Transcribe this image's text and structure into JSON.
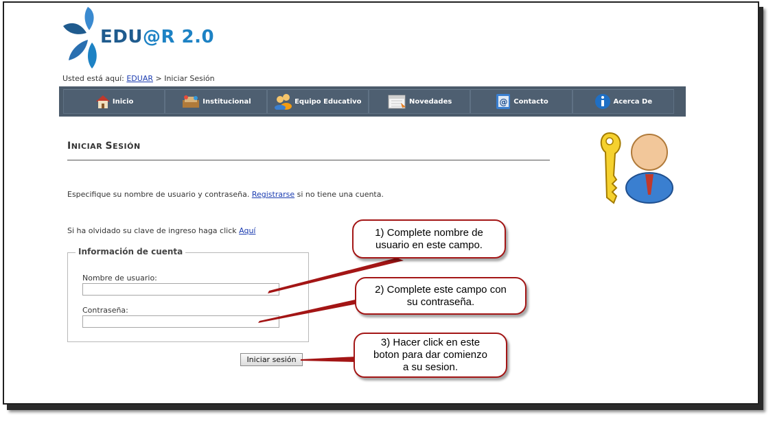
{
  "logo": {
    "word1": "EDU",
    "word2": "@R 2.0"
  },
  "breadcrumb": {
    "prefix": "Usted está aquí:",
    "link": "EDUAR",
    "separator": ">",
    "current": "Iniciar Sesión"
  },
  "nav": {
    "items": [
      {
        "label": "Inicio",
        "icon": "home-icon"
      },
      {
        "label": "Institucional",
        "icon": "institution-icon"
      },
      {
        "label": "Equipo Educativo",
        "icon": "team-icon"
      },
      {
        "label": "Novedades",
        "icon": "calendar-icon"
      },
      {
        "label": "Contacto",
        "icon": "contact-icon"
      },
      {
        "label": "Acerca De",
        "icon": "info-icon"
      }
    ]
  },
  "page": {
    "title_first": "I",
    "title_rest": "NICIAR ",
    "title_second": "S",
    "title_rest2": "ESIÓN",
    "intro_before": "Especifique su nombre de usuario y contraseña.",
    "intro_link": "Registrarse",
    "intro_after": "si no tiene una cuenta.",
    "forgot_before": "Si ha olvidado su clave de ingreso haga click",
    "forgot_link": "Aquí"
  },
  "form": {
    "legend": "Información de cuenta",
    "username_label": "Nombre de usuario:",
    "username_value": "",
    "password_label": "Contraseña:",
    "password_value": "",
    "submit_label": "Iniciar sesión"
  },
  "callouts": {
    "c1": [
      "1) Complete nombre de",
      "usuario en este campo."
    ],
    "c2": [
      "2) Complete este campo con",
      "su contraseña."
    ],
    "c3": [
      "3) Hacer click en este",
      "boton para dar comienzo",
      "a su sesion."
    ]
  },
  "colors": {
    "nav_bg": "#4b5b6b",
    "callout_border": "#a31515",
    "link": "#1a3bb0"
  }
}
